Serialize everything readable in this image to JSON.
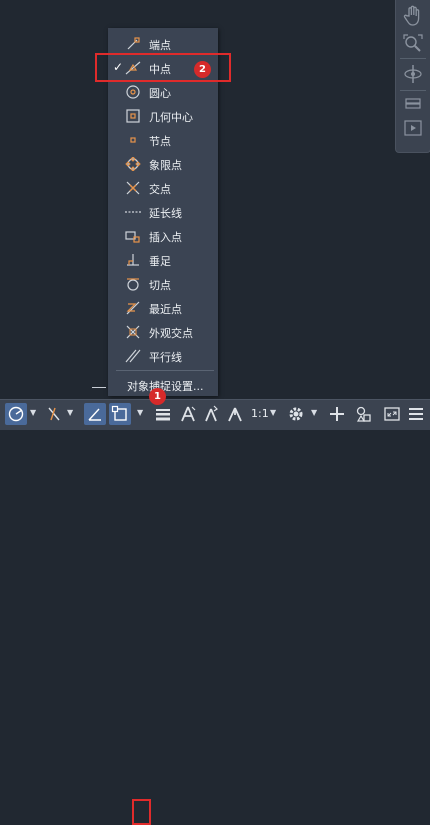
{
  "menu": {
    "items": [
      {
        "label": "端点",
        "icon": "endpoint-icon",
        "checked": false
      },
      {
        "label": "中点",
        "icon": "midpoint-icon",
        "checked": true
      },
      {
        "label": "圆心",
        "icon": "center-icon",
        "checked": false
      },
      {
        "label": "几何中心",
        "icon": "geometric-center-icon",
        "checked": false
      },
      {
        "label": "节点",
        "icon": "node-icon",
        "checked": false
      },
      {
        "label": "象限点",
        "icon": "quadrant-icon",
        "checked": false
      },
      {
        "label": "交点",
        "icon": "intersection-icon",
        "checked": false
      },
      {
        "label": "延长线",
        "icon": "extension-icon",
        "checked": false
      },
      {
        "label": "插入点",
        "icon": "insertion-icon",
        "checked": false
      },
      {
        "label": "垂足",
        "icon": "perpendicular-icon",
        "checked": false
      },
      {
        "label": "切点",
        "icon": "tangent-icon",
        "checked": false
      },
      {
        "label": "最近点",
        "icon": "nearest-icon",
        "checked": false
      },
      {
        "label": "外观交点",
        "icon": "apparent-intersection-icon",
        "checked": false
      },
      {
        "label": "平行线",
        "icon": "parallel-icon",
        "checked": false
      }
    ],
    "settings_label": "对象捕捉设置...",
    "checkmark": "✓"
  },
  "annotations": {
    "badge1": "1",
    "badge2": "2"
  },
  "statusbar": {
    "zoom_label": "1:1"
  },
  "colors": {
    "accent_orange": "#e8944a",
    "highlight_red": "#e02b2b",
    "active_blue": "#4a6a9a"
  }
}
